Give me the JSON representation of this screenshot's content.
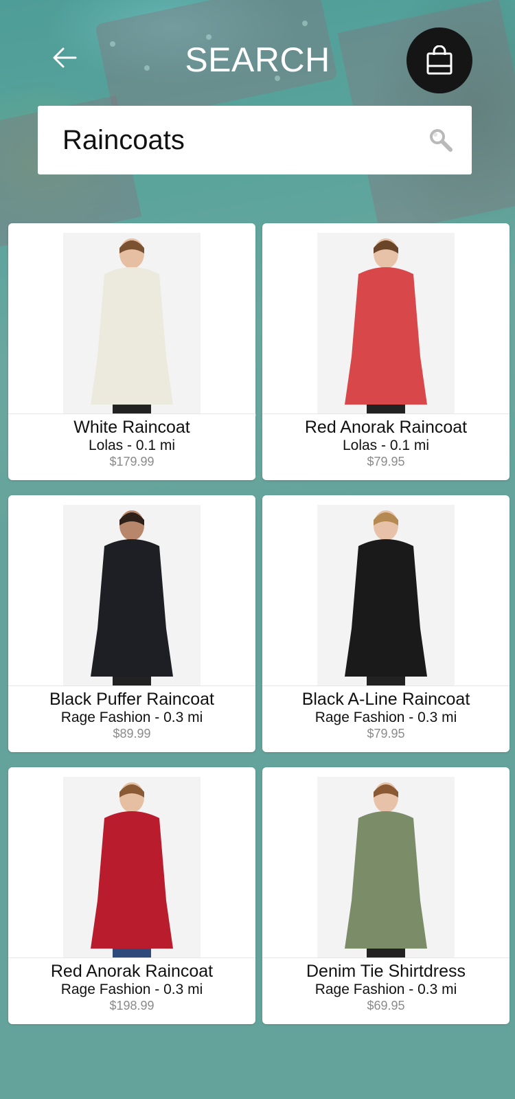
{
  "header": {
    "title": "SEARCH",
    "back_icon": "arrow-left-icon",
    "bag_icon": "shopping-bag-icon"
  },
  "search": {
    "value": "Raincoats",
    "icon": "magnifier-icon"
  },
  "colors": {
    "background": "#64a39b",
    "card": "#ffffff",
    "bag_button": "#151515",
    "price": "#8a8a8a"
  },
  "products": [
    {
      "name": "White Raincoat",
      "store": "Lolas - 0.1 mi",
      "price": "$179.99",
      "coat_color": "#ece9dd"
    },
    {
      "name": "Red Anorak Raincoat",
      "store": "Lolas - 0.1 mi",
      "price": "$79.95",
      "coat_color": "#d8484a"
    },
    {
      "name": "Black Puffer Raincoat",
      "store": "Rage Fashion - 0.3 mi",
      "price": "$89.99",
      "coat_color": "#1e1f24"
    },
    {
      "name": "Black A-Line Raincoat",
      "store": "Rage Fashion - 0.3 mi",
      "price": "$79.95",
      "coat_color": "#1a1a1a"
    },
    {
      "name": "Red Anorak Raincoat",
      "store": "Rage Fashion - 0.3 mi",
      "price": "$198.99",
      "coat_color": "#b91c2c"
    },
    {
      "name": "Denim Tie Shirtdress",
      "store": "Rage Fashion - 0.3 mi",
      "price": "$69.95",
      "coat_color": "#7b8c68"
    }
  ]
}
